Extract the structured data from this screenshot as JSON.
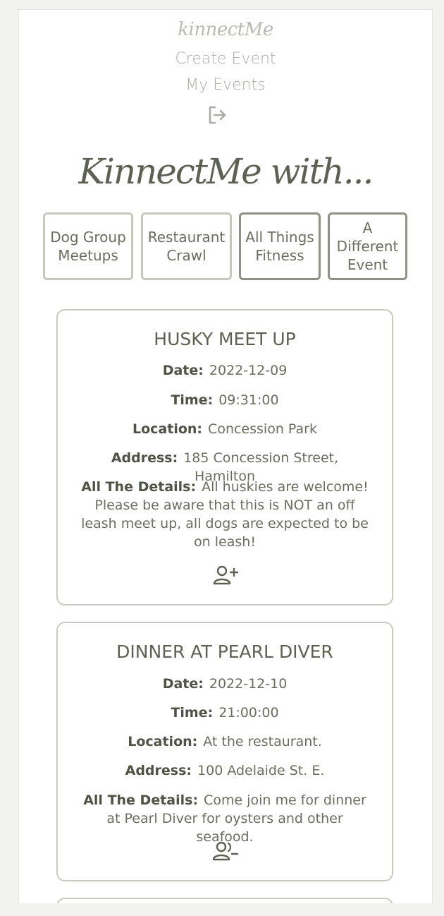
{
  "header": {
    "brand": "kinnectMe",
    "nav": {
      "create_event": "Create Event",
      "my_events": "My Events",
      "logout_icon": "logout-icon"
    }
  },
  "hero": {
    "title": "KinnectMe with..."
  },
  "filters": [
    {
      "label": "Dog Group Meetups"
    },
    {
      "label": "Restaurant Crawl"
    },
    {
      "label": "All Things Fitness"
    },
    {
      "label": "A Different Event"
    }
  ],
  "events": [
    {
      "title": "HUSKY MEET UP",
      "date_label": "Date:",
      "date": "2022-12-09",
      "time_label": "Time:",
      "time": "09:31:00",
      "location_label": "Location:",
      "location": "Concession Park",
      "address_label": "Address:",
      "address": "185 Concession Street, Hamilton",
      "details_label": "All The Details:",
      "details": "All huskies are welcome! Please be aware that this is NOT an off leash meet up, all dogs are expected to be on leash!",
      "action_icon": "user-plus-icon"
    },
    {
      "title": "DINNER AT PEARL DIVER",
      "date_label": "Date:",
      "date": "2022-12-10",
      "time_label": "Time:",
      "time": "21:00:00",
      "location_label": "Location:",
      "location": "At the restaurant.",
      "address_label": "Address:",
      "address": "100 Adelaide St. E.",
      "details_label": "All The Details:",
      "details": "Come join me for dinner at Pearl Diver for oysters and other seafood.",
      "action_icon": "user-minus-icon"
    }
  ],
  "colors": {
    "accent": "#5d6153",
    "muted": "#a9aca4",
    "border": "#c8cbbf"
  }
}
